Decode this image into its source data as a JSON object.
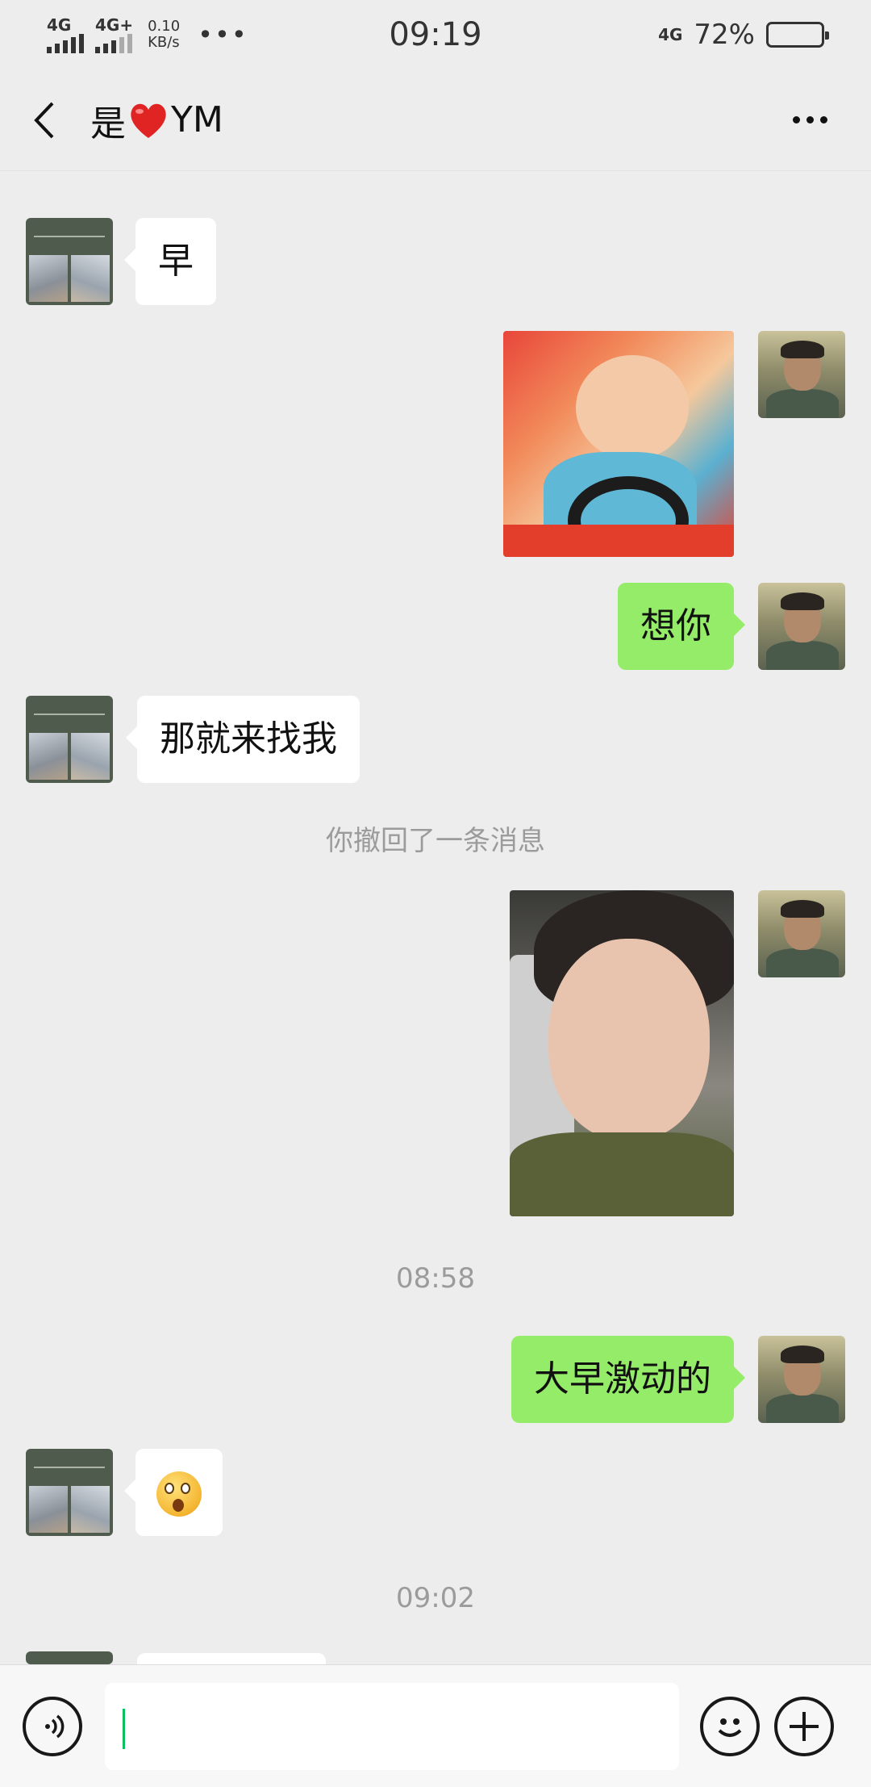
{
  "status_bar": {
    "signal1_label": "4G",
    "signal2_label": "4G+",
    "net_speed_value": "0.10",
    "net_speed_unit": "KB/s",
    "more": "•••",
    "time": "09:19",
    "network_type": "4G",
    "battery_percent_text": "72%",
    "battery_level": 0.72
  },
  "nav": {
    "title_prefix": "是",
    "title_suffix": "YM",
    "back_icon": "chevron-left-icon",
    "more_icon": "more-horizontal-icon"
  },
  "messages": [
    {
      "side": "in",
      "type": "text",
      "text": "早"
    },
    {
      "side": "out",
      "type": "image",
      "image": "crying-baby-sticker"
    },
    {
      "side": "out",
      "type": "text",
      "text": "想你"
    },
    {
      "side": "in",
      "type": "text",
      "text": "那就来找我"
    },
    {
      "type": "system",
      "text": "你撤回了一条消息"
    },
    {
      "side": "out",
      "type": "image",
      "image": "girl-selfie-photo"
    },
    {
      "type": "timestamp",
      "text": "08:58"
    },
    {
      "side": "out",
      "type": "text",
      "text": "大早激动的"
    },
    {
      "side": "in",
      "type": "emoji",
      "emoji": "surprised-face-icon"
    },
    {
      "type": "timestamp",
      "text": "09:02"
    }
  ],
  "input_bar": {
    "voice_icon": "voice-icon",
    "emoji_icon": "emoji-icon",
    "plus_icon": "plus-icon",
    "value": ""
  },
  "colors": {
    "background": "#ededed",
    "outgoing_bubble": "#95ec69",
    "incoming_bubble": "#ffffff",
    "system_text": "#9b9b9b",
    "caret": "#07c160"
  }
}
